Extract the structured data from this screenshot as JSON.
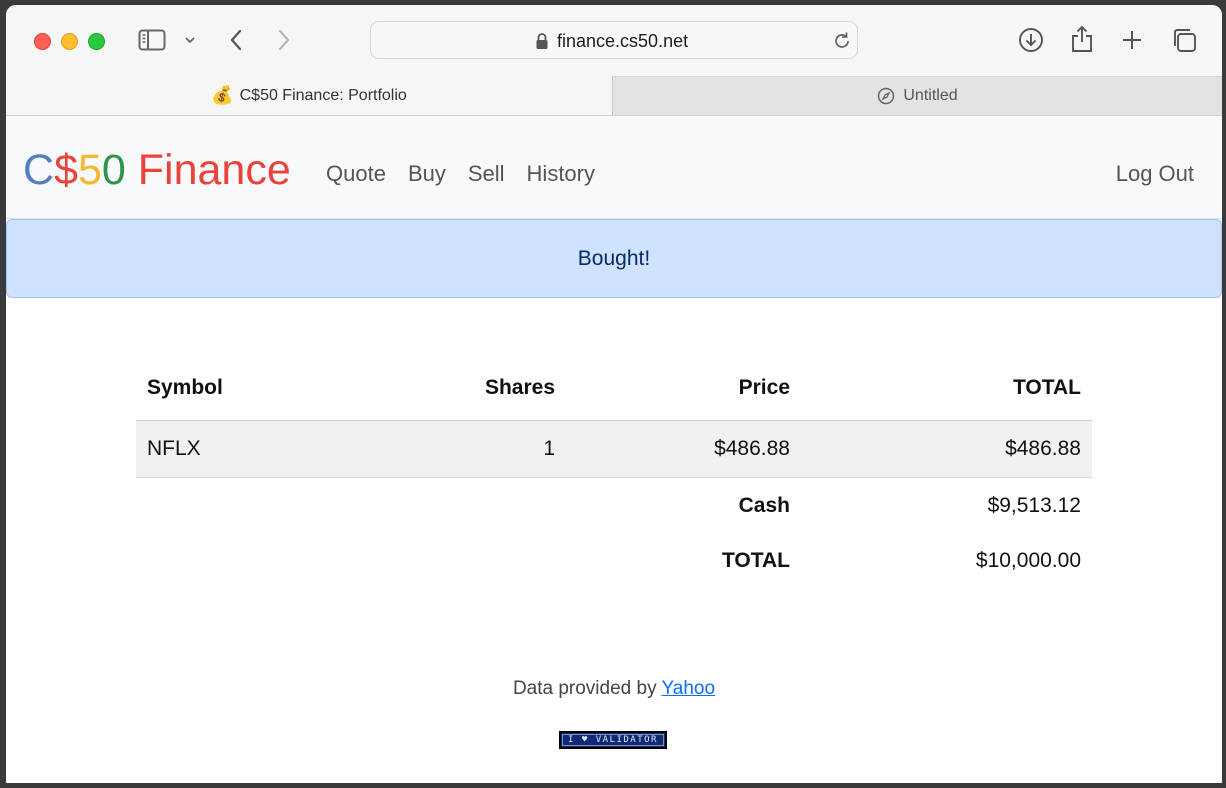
{
  "browser": {
    "url": "finance.cs50.net",
    "tabs": [
      {
        "label": "C$50 Finance: Portfolio",
        "favicon": "💰",
        "active": true
      },
      {
        "label": "Untitled",
        "active": false
      }
    ],
    "icons": [
      "sidebar-icon",
      "chevron-down-icon",
      "back-icon",
      "forward-icon",
      "lock-icon",
      "reload-icon",
      "download-icon",
      "share-icon",
      "new-tab-icon",
      "tab-overview-icon",
      "compass-icon"
    ]
  },
  "navbar": {
    "brand": {
      "c": "C",
      "dollar": "$",
      "five": "5",
      "zero": "0",
      "finance": " Finance"
    },
    "links": [
      "Quote",
      "Buy",
      "Sell",
      "History"
    ],
    "logout": "Log Out"
  },
  "alert": {
    "message": "Bought!"
  },
  "table": {
    "headers": [
      "Symbol",
      "Shares",
      "Price",
      "TOTAL"
    ],
    "rows": [
      {
        "symbol": "NFLX",
        "shares": "1",
        "price": "$486.88",
        "total": "$486.88"
      }
    ],
    "cash_label": "Cash",
    "cash_value": "$9,513.12",
    "total_label": "TOTAL",
    "total_value": "$10,000.00"
  },
  "footer": {
    "text": "Data provided by ",
    "link": "Yahoo",
    "badge": "I ♥ VALIDATOR"
  },
  "colors": {
    "brand_blue": "#537fbe",
    "brand_red": "#ea433b",
    "brand_yellow": "#f5b82e",
    "brand_green": "#2e944b",
    "alert_bg": "#cfe2ff",
    "link": "#0d6efd"
  }
}
